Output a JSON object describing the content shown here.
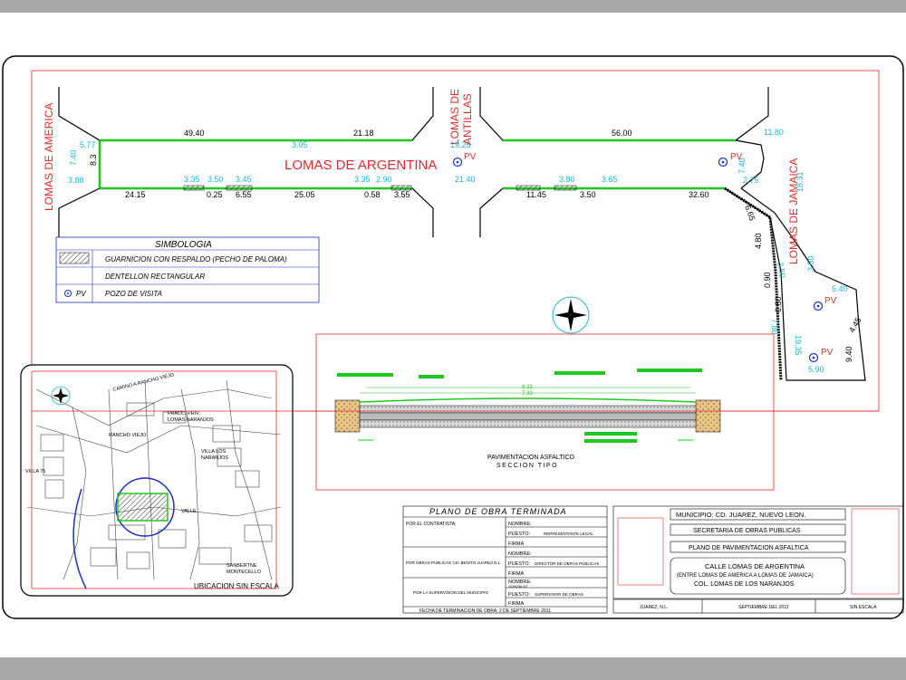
{
  "streets": {
    "main": "LOMAS DE ARGENTINA",
    "left": "LOMAS DE AMERICA",
    "middle_line1": "LOMAS DE",
    "middle_line2": "ANTILLAS",
    "right": "LOMAS DE JAMAICA"
  },
  "dims_black": {
    "top_left": "49.40",
    "top_mid": "21.18",
    "top_right": "56.00",
    "b1": "24.15",
    "b2": "0.25",
    "b3": "6.55",
    "b4": "25.05",
    "b5": "0.58",
    "b6": "3.55",
    "b7": "11.45",
    "b8": "3.50",
    "b9": "32.60",
    "v1": "8.3",
    "r1": "6.65",
    "r2": "4.80",
    "r3": "0.90",
    "r4": "0.80",
    "r5": "4.45",
    "r6": "9.40"
  },
  "dims_cyan": {
    "c1": "5.77",
    "c2": "7.40",
    "c3": "3.88",
    "c4": "3.95",
    "c5": "3.35",
    "c6": "3.50",
    "c7": "3.45",
    "c8": "3.35",
    "c9": "2.90",
    "c10": "19.25",
    "c11": "21.40",
    "c12": "3.80",
    "c13": "3.65",
    "c14": "11.80",
    "c15": "7.40",
    "c16": "2.75",
    "c17": "18.31",
    "c18": "3.50",
    "c19": "5.40",
    "c20": "19.35",
    "c21": "5.90",
    "c22": "7.80",
    "c23": "3.50"
  },
  "pv_label": "PV",
  "legend": {
    "title": "SIMBOLOGIA",
    "items": [
      {
        "symbol": "hatch",
        "label": "GUARNICION CON RESPALDO (PECHO DE PALOMA)"
      },
      {
        "symbol": "line",
        "label": "DENTELLON RECTANGULAR"
      },
      {
        "symbol": "PV",
        "label": "POZO DE VISITA"
      }
    ]
  },
  "section": {
    "title1": "PAVIMENTACION ASFALTICO",
    "title2": "SECCION TIPO",
    "dim1": "8.33",
    "dim2": "7.33"
  },
  "location_map": {
    "caption": "UBICACION SIN ESCALA",
    "labels": {
      "l1": "CAMINO A RANCHO VIEJO",
      "l2": "FRACC. PRIV.",
      "l3": "LOMAS NARANJOS",
      "l4": "RANCHO VIEJO",
      "l5": "VILLA LOS",
      "l6": "NARANJOS",
      "l7": "VALLE",
      "l8": "SANBERTNE",
      "l9": "MONTECELLO",
      "l10": "VILLA 75"
    }
  },
  "obra_table": {
    "title": "PLANO DE OBRA TERMINADA",
    "row1_left": "POR EL CONTRATISTA:",
    "row2_left": "POR OBRAS PUBLICAS CD. BENITO JUAREZ N.L.",
    "row3_left": "POR LA SUPERVISION DEL MUNICIPIO",
    "nombre": "NOMBRE:",
    "puesto": "PUESTO:",
    "firma": "FIRMA",
    "p1": "REPRESENTANTE LEGAL",
    "p2": "DIRECTOR DE OBRAS PUBLICAS",
    "n3": "GONZALEZ",
    "p3": "SUPERVISOR DE OBRAS",
    "footer": "FECHA DE TERMINACION DE OBRA:   2 DE SEPTIEMBRE 2011"
  },
  "title_block": {
    "municipio": "MUNICIPIO:  CD.  JUAREZ,  NUEVO  LEON.",
    "secretaria": "SECRETARIA  DE  OBRAS  PUBLICAS",
    "plano": "PLANO  DE  PAVIMENTACION  ASFALTICA",
    "calle1": "CALLE  LOMAS  DE  ARGENTINA",
    "calle2": "(ENTRE LOMAS DE AMERICA  A LOMAS DE JAMAICA)",
    "calle3": "COL.  LOMAS  DE  LOS  NARANJOS",
    "foot1": "JUAREZ, N.L.",
    "foot2": "SEPTIEMBRE DEL 2011",
    "foot3": "SIN ESCALA"
  },
  "colors": {
    "red": "#e32a2a",
    "cyan": "#19b7d6",
    "green": "#1ec81e",
    "blue": "#1c2fc9",
    "band": "#a9a9a9"
  }
}
